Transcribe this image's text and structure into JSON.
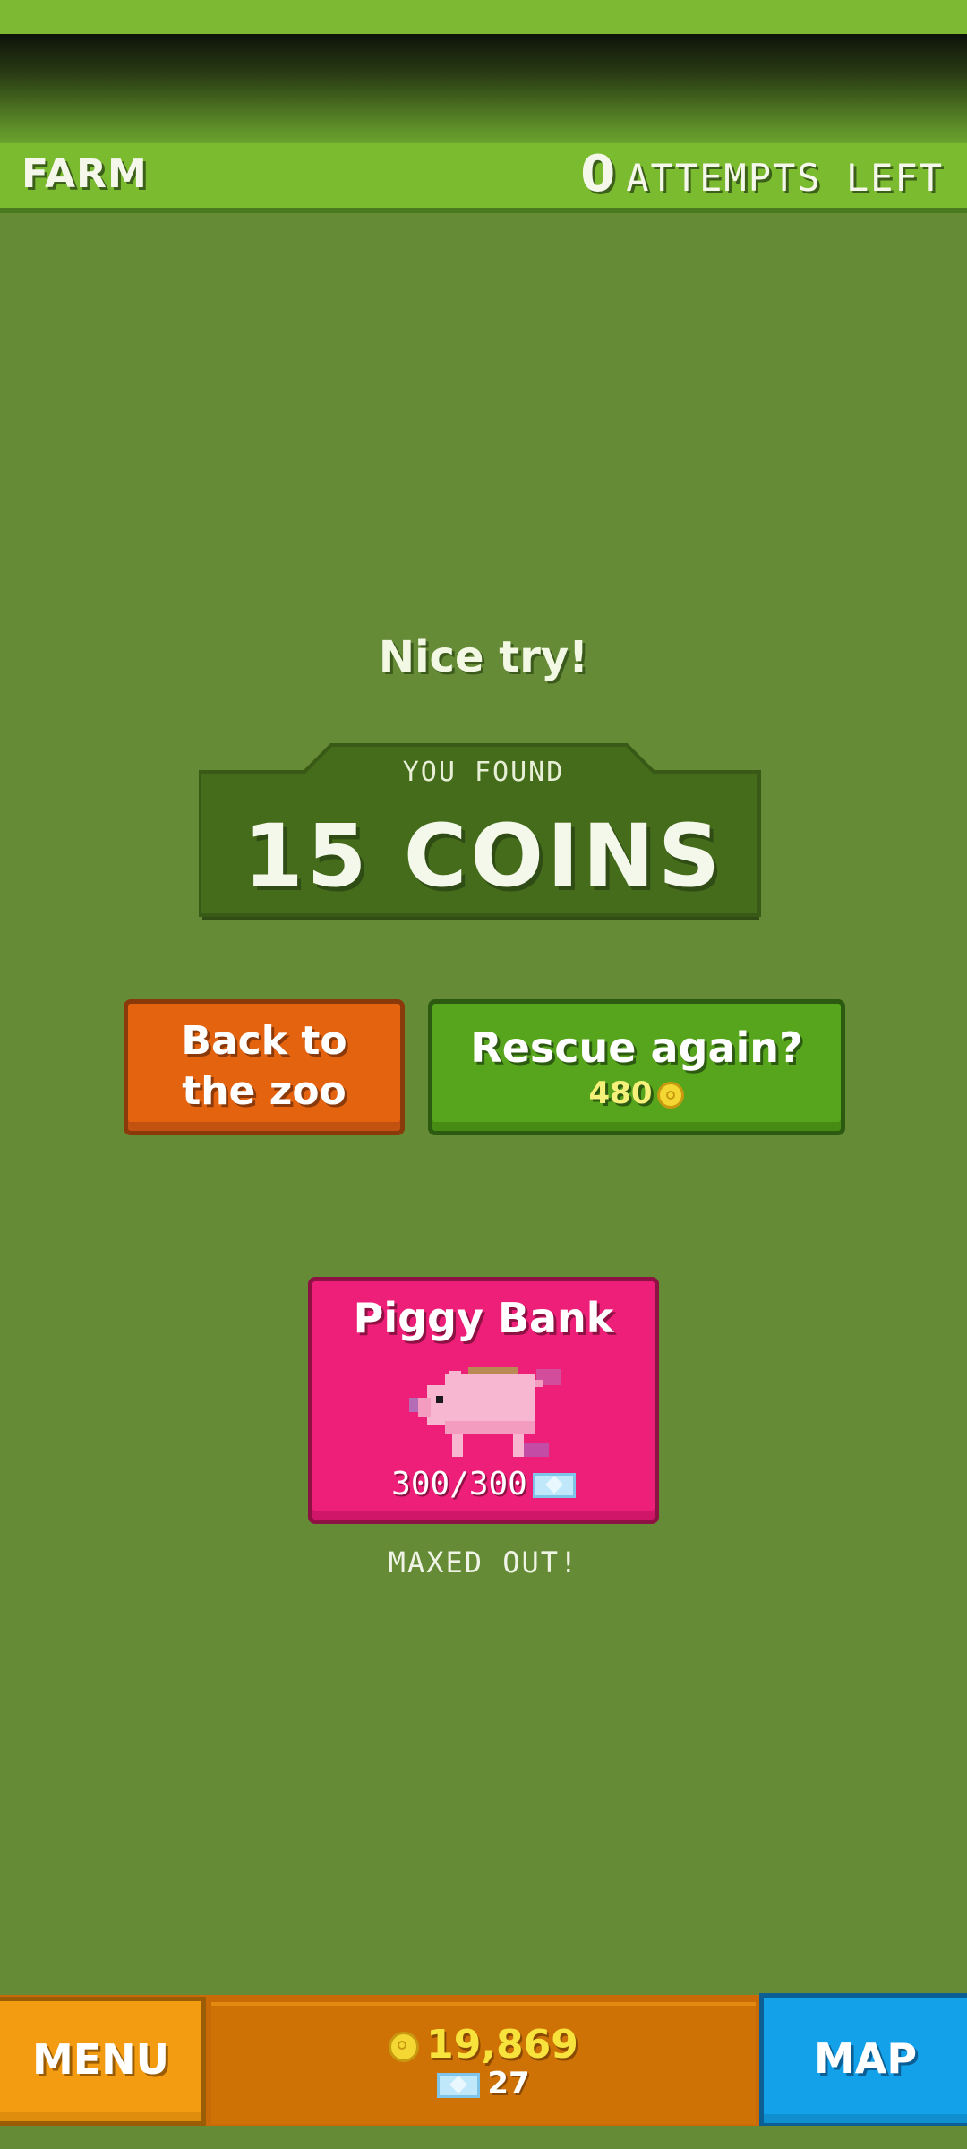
{
  "header": {
    "location": "FARM",
    "attempts_count": "0",
    "attempts_label": "ATTEMPTS LEFT"
  },
  "result": {
    "message": "Nice try!",
    "found_label": "YOU FOUND",
    "found_value": "15 COINS"
  },
  "actions": {
    "back_line1": "Back to",
    "back_line2": "the zoo",
    "rescue_label": "Rescue again?",
    "rescue_price": "480"
  },
  "piggy_bank": {
    "title": "Piggy Bank",
    "progress": "300/300",
    "fill_fraction": 1.0,
    "status": "MAXED OUT!"
  },
  "footer": {
    "menu_label": "MENU",
    "coins": "19,869",
    "gems": "27",
    "map_label": "MAP"
  },
  "colors": {
    "background": "#658b36",
    "topbar": "#7bbb2f",
    "back_button": "#e4630f",
    "rescue_button": "#57a51c",
    "piggy_card": "#ee1f79",
    "menu_button": "#f39c12",
    "map_button": "#13a1ea",
    "coin": "#f5d733"
  },
  "icons": {
    "coin": "coin-icon",
    "gem": "gem-icon",
    "pig": "pig-icon"
  }
}
